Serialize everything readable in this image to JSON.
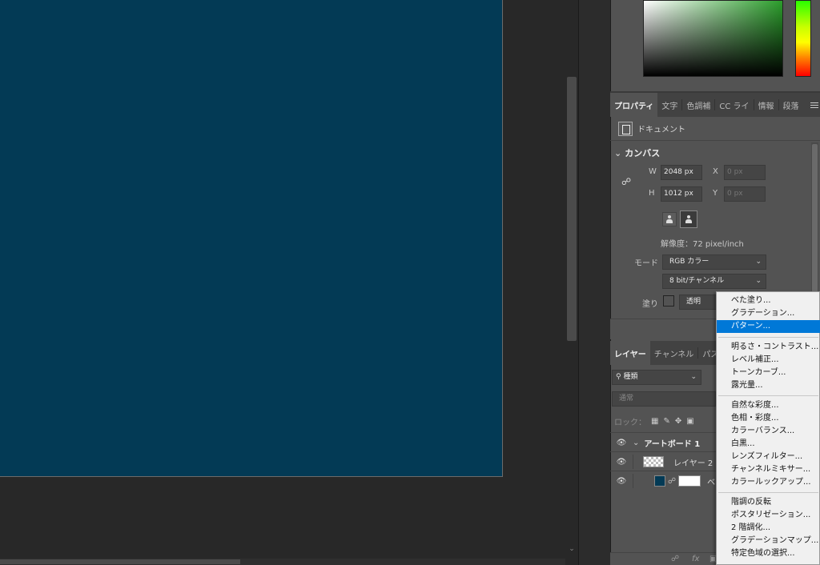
{
  "properties_tabs": [
    {
      "label": "プロパティ",
      "active": true
    },
    {
      "label": "文字"
    },
    {
      "label": "色調補"
    },
    {
      "label": "CC ライ"
    },
    {
      "label": "情報"
    },
    {
      "label": "段落"
    }
  ],
  "document_label": "ドキュメント",
  "canvas_section": {
    "title": "カンバス",
    "w_label": "W",
    "w_value": "2048 px",
    "h_label": "H",
    "h_value": "1012 px",
    "x_label": "X",
    "x_placeholder": "0 px",
    "y_label": "Y",
    "y_placeholder": "0 px",
    "resolution": "解像度：72 pixel/inch",
    "mode_label": "モード",
    "mode_value": "RGB カラー",
    "bit_value": "8 bit/チャンネル",
    "fill_label": "塗り",
    "fill_value": "透明"
  },
  "layers_tabs": [
    {
      "label": "レイヤー",
      "active": true
    },
    {
      "label": "チャンネル"
    },
    {
      "label": "パス"
    }
  ],
  "layers_panel": {
    "filter_label": "種類",
    "blend_mode": "通常",
    "lock_label": "ロック：",
    "layers": [
      {
        "name": "アートボード 1",
        "type": "artboard"
      },
      {
        "name": "レイヤー 2",
        "type": "layer"
      },
      {
        "name": "ベ",
        "type": "fill"
      }
    ]
  },
  "adjustment_menu": {
    "groups": [
      [
        "べた塗り...",
        "グラデーション...",
        "パターン..."
      ],
      [
        "明るさ・コントラスト...",
        "レベル補正...",
        "トーンカーブ...",
        "露光量..."
      ],
      [
        "自然な彩度...",
        "色相・彩度...",
        "カラーバランス...",
        "白黒...",
        "レンズフィルター...",
        "チャンネルミキサー...",
        "カラールックアップ..."
      ],
      [
        "階調の反転",
        "ポスタリゼーション...",
        "2 階調化...",
        "グラデーションマップ...",
        "特定色域の選択..."
      ]
    ],
    "selected": "パターン..."
  },
  "colors": {
    "canvas": "#033a55",
    "panel": "#535353",
    "menu_highlight": "#0078d7"
  }
}
